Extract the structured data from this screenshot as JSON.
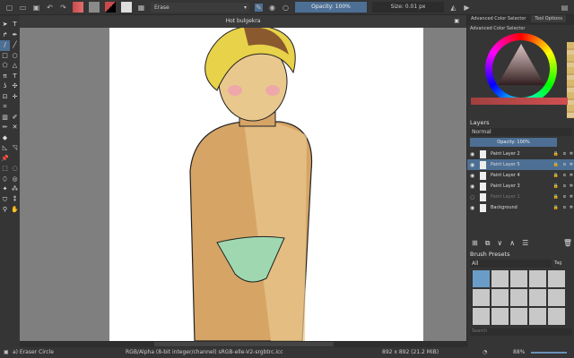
{
  "toolbar": {
    "preset_name": "Erase",
    "opacity": "Opacity: 100%",
    "size": "Size: 0.01 px",
    "fg_color": "#c94a4a",
    "bg_color": "#8a8a8a"
  },
  "document": {
    "title": "Hot bulgekra"
  },
  "right_panel": {
    "tabs": [
      "Advanced Color Selector",
      "Tool Options"
    ],
    "color_header": "Advanced Color Selector",
    "layers_header": "Layers",
    "blend_mode": "Normal",
    "layer_opacity": "Opacity:  100%",
    "layers": [
      {
        "name": "Paint Layer 2",
        "selected": false,
        "visible": true
      },
      {
        "name": "Paint Layer 5",
        "selected": true,
        "visible": true
      },
      {
        "name": "Paint Layer 4",
        "selected": false,
        "visible": true
      },
      {
        "name": "Paint Layer 3",
        "selected": false,
        "visible": true
      },
      {
        "name": "Paint Layer 1",
        "selected": false,
        "visible": false
      },
      {
        "name": "Background",
        "selected": false,
        "visible": true
      }
    ],
    "brush_header": "Brush Presets",
    "brush_filter": "All",
    "tag_label": "Tag",
    "search_placeholder": "Search"
  },
  "status": {
    "tool": "a) Eraser Circle",
    "color_space": "RGB/Alpha (8-bit integer/channel)  sRGB-elle-V2-srgbtrc.icc",
    "dimensions": "892 x 892 (21.2 MiB)",
    "zoom": "88%"
  },
  "accent": "#4d6f94"
}
